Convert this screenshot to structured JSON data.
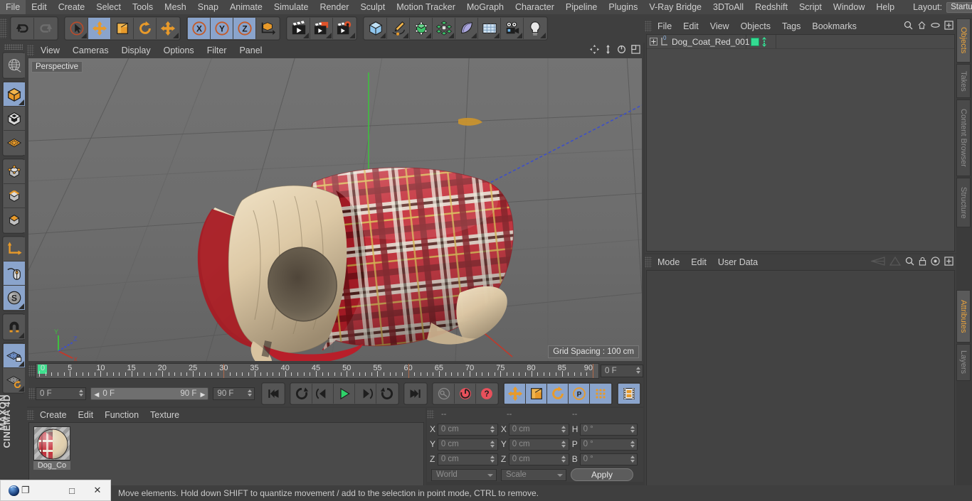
{
  "app": {
    "brand_line1": "MAXON",
    "brand_line2": "CINEMA 4D"
  },
  "menubar": {
    "items": [
      "File",
      "Edit",
      "Create",
      "Select",
      "Tools",
      "Mesh",
      "Snap",
      "Animate",
      "Simulate",
      "Render",
      "Sculpt",
      "Motion Tracker",
      "MoGraph",
      "Character",
      "Pipeline",
      "Plugins",
      "V-Ray Bridge",
      "3DToAll",
      "Redshift",
      "Script",
      "Window",
      "Help"
    ],
    "layout_label": "Layout:",
    "layout_value": "Startup",
    "search_icon": "search-icon"
  },
  "toolbar": {
    "groups": [
      {
        "name": "undo-redo",
        "buttons": [
          {
            "name": "undo-button",
            "icon": "undo-arrow-icon",
            "active": false
          },
          {
            "name": "redo-button",
            "icon": "redo-arrow-icon",
            "active": false,
            "disabled": true
          }
        ]
      },
      {
        "name": "transform-tools",
        "buttons": [
          {
            "name": "live-selection-tool",
            "icon": "cursor-circle-icon",
            "active": false,
            "corner": true
          },
          {
            "name": "move-tool",
            "icon": "move-arrows-icon",
            "active": true
          },
          {
            "name": "scale-tool",
            "icon": "scale-box-icon",
            "active": false
          },
          {
            "name": "rotate-tool",
            "icon": "rotate-arc-icon",
            "active": false
          },
          {
            "name": "move-alt-tool",
            "icon": "move-arrows-icon",
            "active": false,
            "corner": true
          }
        ]
      },
      {
        "name": "axis-locks",
        "buttons": [
          {
            "name": "x-axis-lock",
            "icon": "x-axis-icon",
            "active": true
          },
          {
            "name": "y-axis-lock",
            "icon": "y-axis-icon",
            "active": true
          },
          {
            "name": "z-axis-lock",
            "icon": "z-axis-icon",
            "active": true
          },
          {
            "name": "world-object-axis-toggle",
            "icon": "world-axis-cube-icon",
            "active": false
          }
        ]
      },
      {
        "name": "render-tools",
        "buttons": [
          {
            "name": "render-view-button",
            "icon": "clapboard-icon",
            "active": false,
            "corner": true
          },
          {
            "name": "render-to-picture-viewer-button",
            "icon": "clapboard-window-icon",
            "active": false,
            "corner": true
          },
          {
            "name": "render-settings-button",
            "icon": "clapboard-gear-icon",
            "active": false,
            "corner": true
          }
        ]
      },
      {
        "name": "create-objects",
        "buttons": [
          {
            "name": "add-cube-button",
            "icon": "blue-cube-icon",
            "active": false,
            "corner": true
          },
          {
            "name": "add-spline-button",
            "icon": "pen-spline-icon",
            "active": false,
            "corner": true
          },
          {
            "name": "add-generator-button",
            "icon": "green-cube-icon",
            "active": false,
            "corner": true
          },
          {
            "name": "add-array-button",
            "icon": "green-cluster-icon",
            "active": false,
            "corner": true
          },
          {
            "name": "add-deformer-button",
            "icon": "bend-deformer-icon",
            "active": false,
            "corner": true
          },
          {
            "name": "add-environment-button",
            "icon": "floor-grid-icon",
            "active": false,
            "corner": true
          },
          {
            "name": "add-camera-button",
            "icon": "camera-icon",
            "active": false,
            "corner": true
          },
          {
            "name": "add-light-button",
            "icon": "lightbulb-icon",
            "active": false,
            "corner": true
          }
        ]
      }
    ]
  },
  "leftbar": {
    "buttons": [
      {
        "name": "make-editable-globe-button",
        "icon": "globe-wireframe-icon",
        "active": false
      },
      {
        "name": "model-mode-button",
        "icon": "orange-cube-icon",
        "active": true,
        "corner": true
      },
      {
        "name": "texture-mode-button",
        "icon": "checker-cube-icon",
        "active": false
      },
      {
        "name": "polygon-grid-button",
        "icon": "orange-grid-icon",
        "active": false
      },
      {
        "name": "point-mode-button",
        "icon": "point-cube-icon",
        "active": false
      },
      {
        "name": "edge-mode-button",
        "icon": "edge-cube-icon",
        "active": false
      },
      {
        "name": "polygon-mode-button",
        "icon": "polygon-cube-icon",
        "active": false
      },
      {
        "name": "axis-mode-button",
        "icon": "orange-axis-icon",
        "active": false
      },
      {
        "name": "viewport-solo-button",
        "icon": "mouse-icon",
        "active": true
      },
      {
        "name": "scale-tool-s-button",
        "icon": "s-sphere-icon",
        "active": true,
        "corner": true
      },
      {
        "name": "magnet-snap-button",
        "icon": "magnet-icon",
        "active": false,
        "corner": true
      },
      {
        "name": "lock-workplane-button",
        "icon": "grid-lock-icon",
        "active": true,
        "corner": true
      },
      {
        "name": "reset-workplane-button",
        "icon": "grid-reset-icon",
        "active": false,
        "corner": true
      }
    ]
  },
  "viewport": {
    "menu": [
      "View",
      "Cameras",
      "Display",
      "Options",
      "Filter",
      "Panel"
    ],
    "view_label": "Perspective",
    "grid_spacing": "Grid Spacing : 100 cm",
    "axis_labels": {
      "x": "X",
      "y": "Y",
      "z": "Z"
    },
    "icons": [
      "pan-icon",
      "dolly-icon",
      "orbit-icon",
      "maximize-icon"
    ],
    "model": {
      "name": "Dog_Coat_Red_001",
      "description": "red tartan plaid dog coat with cream fleece lining",
      "colors": {
        "plaid_red": "#c4202b",
        "plaid_dark": "#5c1418",
        "plaid_white": "#e9e5d8",
        "plaid_gold": "#c8a23c",
        "lining": "#e2d0b2"
      }
    },
    "background_color": "#6b6b6b"
  },
  "timeline": {
    "start_frame_field": "0 F",
    "end_frame_field": "90 F",
    "range_start": "0 F",
    "range_end": "90 F",
    "current_frame": "0 F",
    "ruler_min": 0,
    "ruler_max": 90,
    "ruler_labels": [
      0,
      5,
      10,
      15,
      20,
      25,
      30,
      35,
      40,
      45,
      50,
      55,
      60,
      65,
      70,
      75,
      80,
      85,
      90
    ],
    "playhead_frames": [
      30,
      60,
      90
    ],
    "transport": [
      {
        "name": "go-to-start-button",
        "icon": "skip-start-icon",
        "active": false
      },
      {
        "name": "play-backwards-loop-button",
        "icon": "loop-back-icon",
        "active": false
      },
      {
        "name": "previous-frame-button",
        "icon": "step-back-icon",
        "active": false
      },
      {
        "name": "play-button",
        "icon": "play-icon",
        "active": false
      },
      {
        "name": "next-frame-button",
        "icon": "step-forward-icon",
        "active": false
      },
      {
        "name": "play-forwards-loop-button",
        "icon": "loop-forward-icon",
        "active": false
      },
      {
        "name": "go-to-end-button",
        "icon": "skip-end-icon",
        "active": false
      }
    ],
    "keys": [
      {
        "name": "record-key-button",
        "icon": "key-icon",
        "active": false
      },
      {
        "name": "autokeying-button",
        "icon": "red-circle-arrow-icon",
        "active": false
      },
      {
        "name": "keyframe-selection-button",
        "icon": "red-question-icon",
        "active": false
      }
    ],
    "key_filters": [
      {
        "name": "position-key-button",
        "icon": "move-arrows-icon",
        "active": true
      },
      {
        "name": "scale-key-button",
        "icon": "scale-box-icon",
        "active": true
      },
      {
        "name": "rotation-key-button",
        "icon": "rotate-arc-icon",
        "active": true
      },
      {
        "name": "parameter-key-button",
        "icon": "p-circle-icon",
        "active": true
      },
      {
        "name": "point-level-animation-button",
        "icon": "dots-grid-icon",
        "active": true
      }
    ],
    "extra": [
      {
        "name": "timeline-mode-button",
        "icon": "film-strip-icon",
        "active": true
      }
    ]
  },
  "material_manager": {
    "menu": [
      "Create",
      "Edit",
      "Function",
      "Texture"
    ],
    "materials": [
      {
        "name": "Dog_Co",
        "preview": "red-plaid-sphere"
      }
    ]
  },
  "coordinates": {
    "header_dashes": [
      "--",
      "--",
      "--"
    ],
    "rows": [
      {
        "pos_label": "X",
        "pos_value": "0 cm",
        "size_label": "X",
        "size_value": "0 cm",
        "rot_label": "H",
        "rot_value": "0 °"
      },
      {
        "pos_label": "Y",
        "pos_value": "0 cm",
        "size_label": "Y",
        "size_value": "0 cm",
        "rot_label": "P",
        "rot_value": "0 °"
      },
      {
        "pos_label": "Z",
        "pos_value": "0 cm",
        "size_label": "Z",
        "size_value": "0 cm",
        "rot_label": "B",
        "rot_value": "0 °"
      }
    ],
    "system_dropdown": "World",
    "mode_dropdown": "Scale",
    "apply_button": "Apply"
  },
  "object_manager": {
    "menu": [
      "File",
      "Edit",
      "View",
      "Objects",
      "Tags",
      "Bookmarks"
    ],
    "icons": [
      "search-icon",
      "home-icon",
      "ellipse-icon",
      "plus-box-icon"
    ],
    "rows": [
      {
        "name": "Dog_Coat_Red_001",
        "level_badge": "0",
        "tag": "green-material-tag",
        "expandable": true
      }
    ]
  },
  "attribute_manager": {
    "menu": [
      "Mode",
      "Edit",
      "User Data"
    ],
    "icons": [
      "history-back-icon",
      "history-forward-icon",
      "search-icon",
      "lock-icon",
      "target-icon",
      "plus-box-icon"
    ]
  },
  "vertical_tabs": {
    "top": [
      {
        "label": "Objects",
        "selected": true
      },
      {
        "label": "Takes",
        "selected": false
      },
      {
        "label": "Content Browser",
        "selected": false
      },
      {
        "label": "Structure",
        "selected": false
      }
    ],
    "bottom": [
      {
        "label": "Attributes",
        "selected": true
      },
      {
        "label": "Layers",
        "selected": false
      }
    ]
  },
  "statusbar": {
    "message": "Move elements. Hold down SHIFT to quantize movement / add to the selection in point mode, CTRL to remove."
  },
  "mini_window": {
    "app_icon": "c4d-orb-icon",
    "restore_label": "❐",
    "maximize_label": "□",
    "close_label": "✕"
  }
}
